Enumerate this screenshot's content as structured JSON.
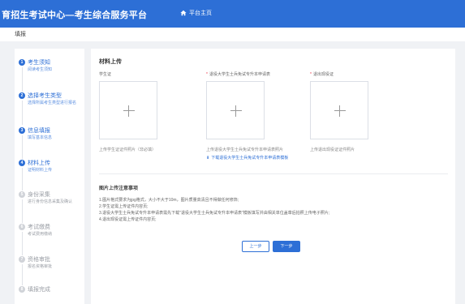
{
  "header": {
    "title": "育招生考试中心—考生综合服务平台",
    "home_label": "平台主页"
  },
  "breadcrumb": "填报",
  "steps": [
    {
      "num": "1",
      "name": "考生须知",
      "desc": "阅读考生须知",
      "active": true
    },
    {
      "num": "2",
      "name": "选择考生类型",
      "desc": "选择所属考生类型进行报名",
      "active": true
    },
    {
      "num": "3",
      "name": "信息填报",
      "desc": "填写基本信息",
      "active": true
    },
    {
      "num": "4",
      "name": "材料上传",
      "desc": "证明材料上传",
      "active": true
    },
    {
      "num": "5",
      "name": "身份采集",
      "desc": "进行身份信息采集及确认",
      "active": false
    },
    {
      "num": "6",
      "name": "考试缴费",
      "desc": "考试费用缴纳",
      "active": false
    },
    {
      "num": "7",
      "name": "资格审批",
      "desc": "报名资格审批",
      "active": false
    },
    {
      "num": "8",
      "name": "填报完成",
      "desc": "",
      "active": false
    }
  ],
  "main": {
    "section_title": "材料上传",
    "uploads": [
      {
        "label": "学生证",
        "required": false,
        "hint": "上传学生证证件照片（非必填）",
        "link": ""
      },
      {
        "label": "退役大学生士兵免试专升本申请表",
        "required": true,
        "hint": "上传退役大学生士兵免试专升本申请表照片",
        "link": "下载退役大学生士兵免试专升本申请表模板"
      },
      {
        "label": "退出现役证",
        "required": true,
        "hint": "上传退出现役证证件照片",
        "link": ""
      }
    ],
    "notes_title": "图片上传注意事项",
    "notes": [
      "1.图片格式要求为jpg格式，大小不大于10m，图片质量高清且不得做任何修饰;",
      "2.学生证需上传证件内容页;",
      "3.退役大学生士兵免试专升本申请表需先下载\"退役大学生士兵免试专升本申请表\"模板填写并由相关单位盖章后拍照上传电子照片;",
      "4.退出现役证需上传证件内容页;"
    ],
    "prev_label": "上一步",
    "next_label": "下一步"
  },
  "colors": {
    "primary": "#2d6fd6",
    "inactive": "#d0d3d8"
  }
}
